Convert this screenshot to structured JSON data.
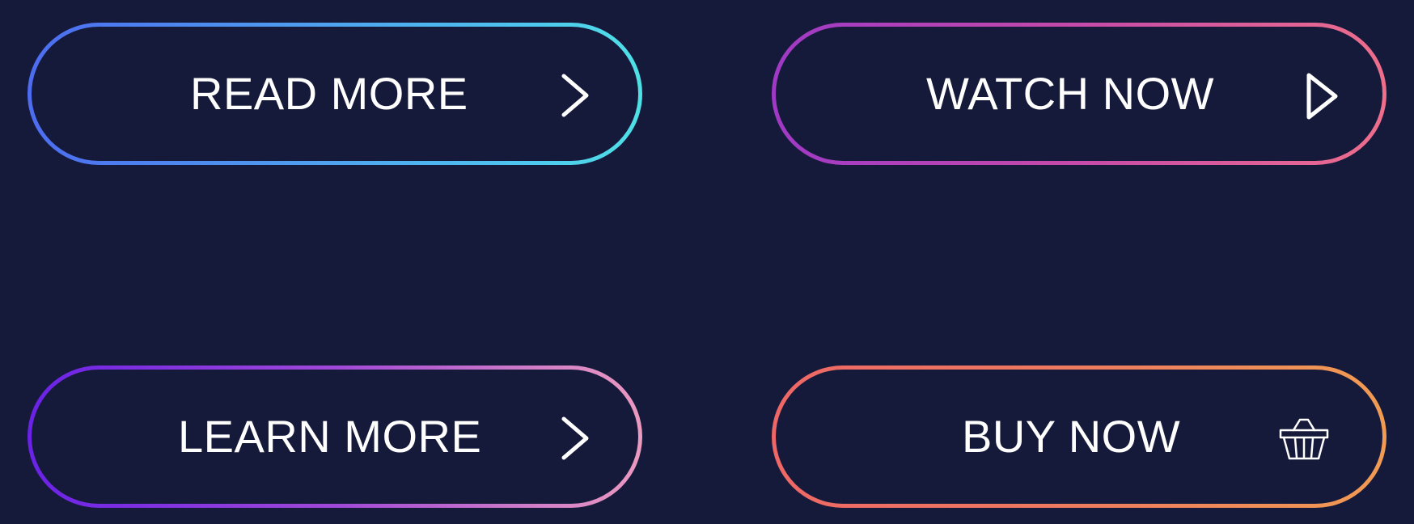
{
  "buttons": [
    {
      "id": "read_more",
      "label": "READ MORE",
      "icon": "chevron-right-icon",
      "gradient": [
        "#4d6cf0",
        "#4fe1e6"
      ]
    },
    {
      "id": "watch_now",
      "label": "WATCH NOW",
      "icon": "play-icon",
      "gradient": [
        "#9f3ac6",
        "#ee6e8c"
      ]
    },
    {
      "id": "learn_more",
      "label": "LEARN MORE",
      "icon": "chevron-right-icon",
      "gradient": [
        "#6a22e6",
        "#eb9ac0"
      ]
    },
    {
      "id": "buy_now",
      "label": "BUY NOW",
      "icon": "basket-icon",
      "gradient": [
        "#ee6766",
        "#f19b53"
      ]
    }
  ],
  "colors": {
    "background": "#161a3a",
    "text": "#ffffff"
  }
}
